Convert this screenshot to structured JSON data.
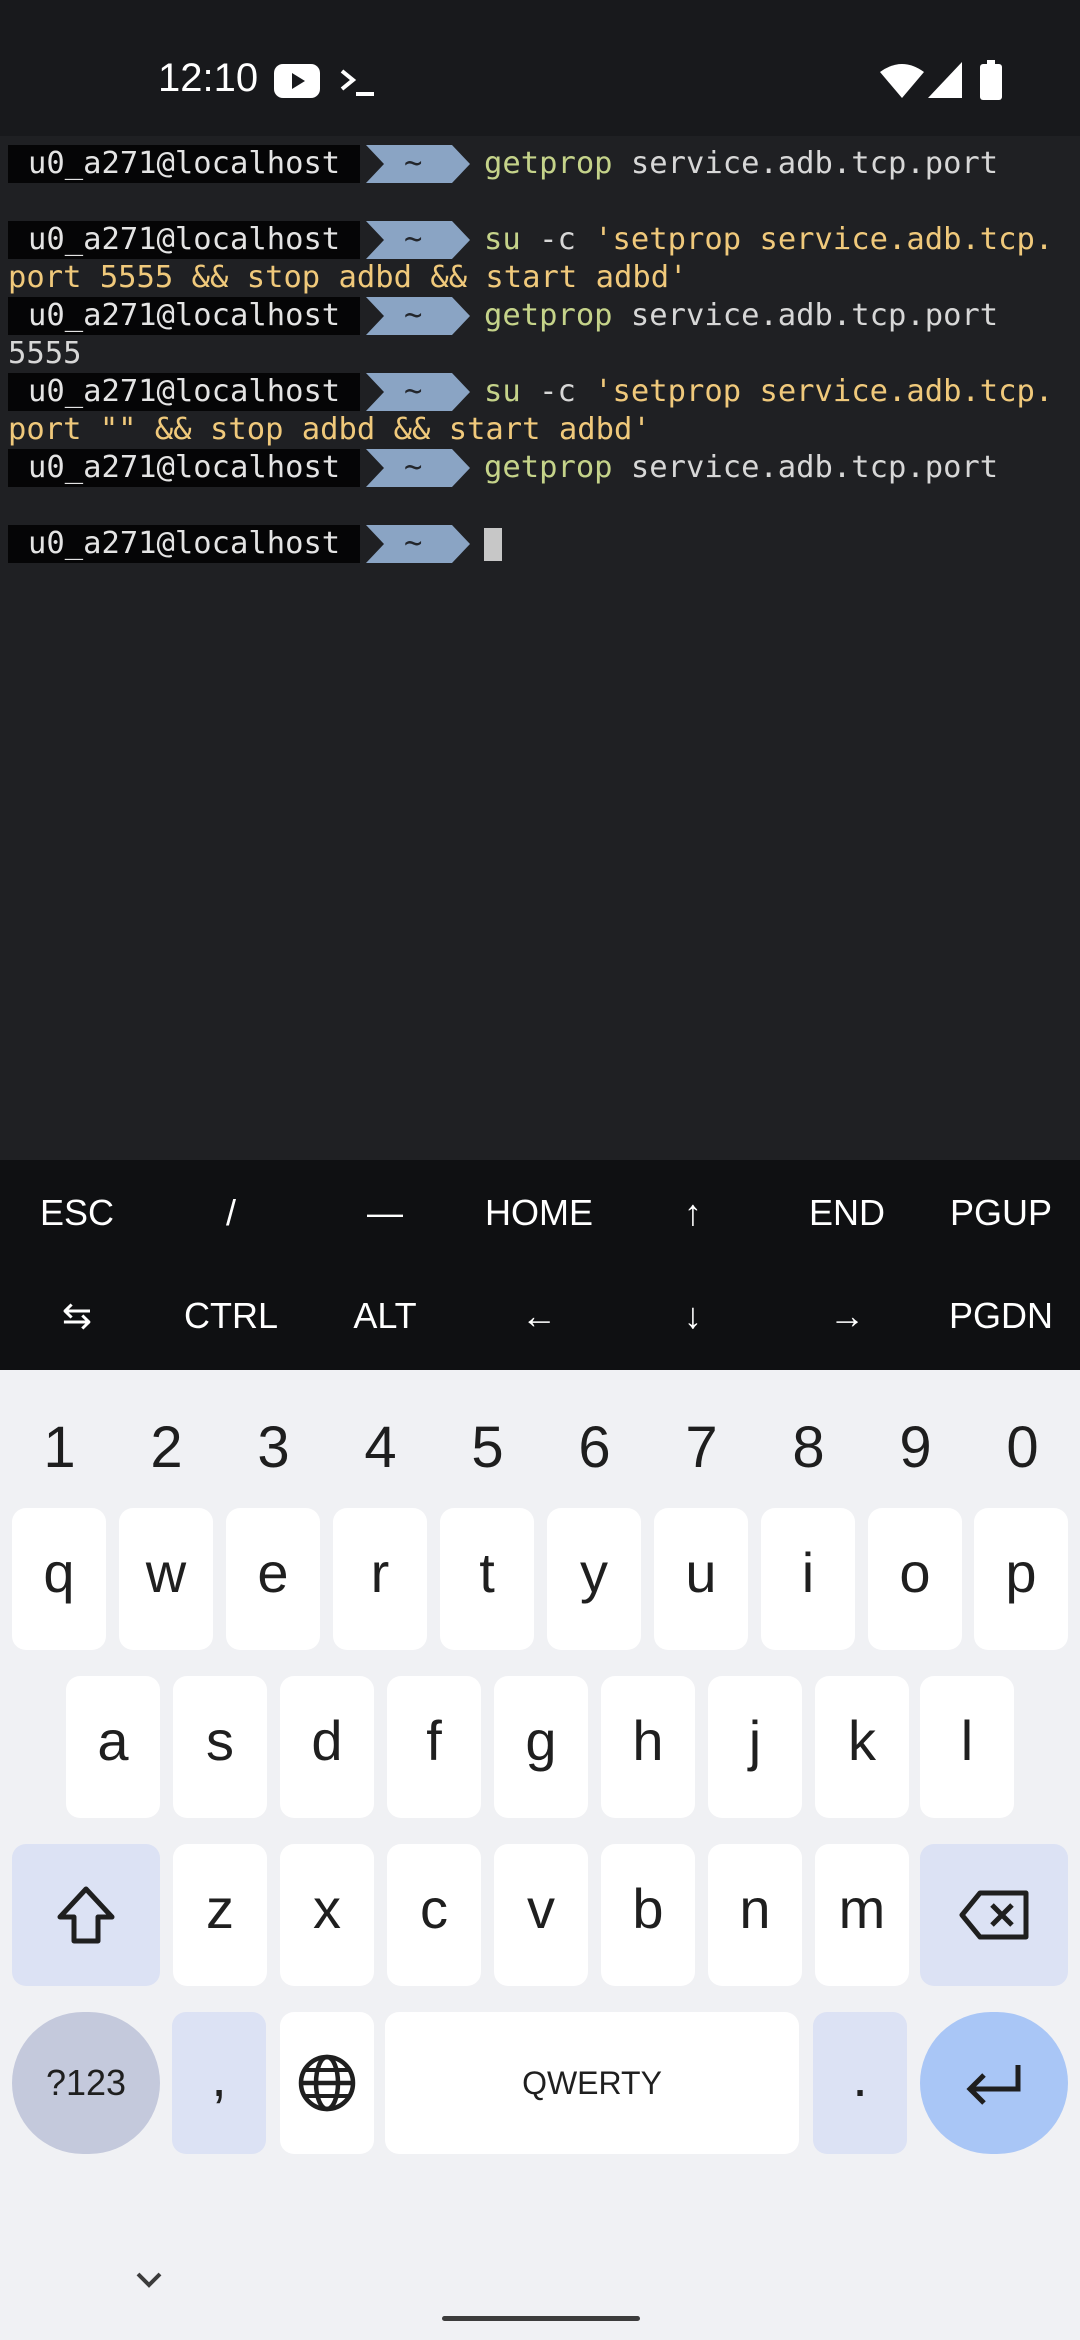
{
  "status_bar": {
    "time": "12:10",
    "left_icons": [
      "youtube-icon",
      "terminal-icon"
    ],
    "right_icons": [
      "wifi-icon",
      "cellular-signal-icon",
      "battery-icon"
    ]
  },
  "terminal": {
    "prompt_user": "u0_a271@localhost",
    "prompt_dir": "~",
    "lines": [
      {
        "type": "prompt",
        "cmd_name": "getprop",
        "cmd_rest": " service.adb.tcp.port"
      },
      {
        "type": "output",
        "text": ""
      },
      {
        "type": "prompt",
        "cmd_name": "su",
        "cmd_rest": " -c ",
        "cmd_str": "'setprop service.adb.tcp."
      },
      {
        "type": "output",
        "text": "port 5555 && stop adbd && start adbd'",
        "color": "yellow"
      },
      {
        "type": "prompt",
        "cmd_name": "getprop",
        "cmd_rest": " service.adb.tcp.port"
      },
      {
        "type": "output",
        "text": "5555"
      },
      {
        "type": "prompt",
        "cmd_name": "su",
        "cmd_rest": " -c ",
        "cmd_str": "'setprop service.adb.tcp."
      },
      {
        "type": "output",
        "text": "port \"\" && stop adbd && start adbd'",
        "color": "yellow"
      },
      {
        "type": "prompt",
        "cmd_name": "getprop",
        "cmd_rest": " service.adb.tcp.port"
      },
      {
        "type": "output",
        "text": ""
      },
      {
        "type": "prompt_cursor"
      }
    ],
    "colors": {
      "bg": "#1f2023",
      "command": "#c5d38a",
      "string": "#f0c97b",
      "dir_segment": "#8aa4c4"
    }
  },
  "extra_keys": {
    "row1": [
      "ESC",
      "/",
      "—",
      "HOME",
      "↑",
      "END",
      "PGUP"
    ],
    "row2": [
      "⇆",
      "CTRL",
      "ALT",
      "←",
      "↓",
      "→",
      "PGDN"
    ]
  },
  "keyboard": {
    "numbers": [
      "1",
      "2",
      "3",
      "4",
      "5",
      "6",
      "7",
      "8",
      "9",
      "0"
    ],
    "row1": [
      "q",
      "w",
      "e",
      "r",
      "t",
      "y",
      "u",
      "i",
      "o",
      "p"
    ],
    "row2": [
      "a",
      "s",
      "d",
      "f",
      "g",
      "h",
      "j",
      "k",
      "l"
    ],
    "row3": [
      "z",
      "x",
      "c",
      "v",
      "b",
      "n",
      "m"
    ],
    "symbols_label": "?123",
    "comma_label": ",",
    "space_label": "QWERTY",
    "period_label": ".",
    "icons": [
      "shift-icon",
      "backspace-icon",
      "globe-icon",
      "enter-icon",
      "hide-keyboard-icon"
    ],
    "colors": {
      "key": "#ffffff",
      "modifier": "#dce2f4",
      "enter": "#a9c6f6",
      "symbols": "#c4c9dc"
    }
  }
}
